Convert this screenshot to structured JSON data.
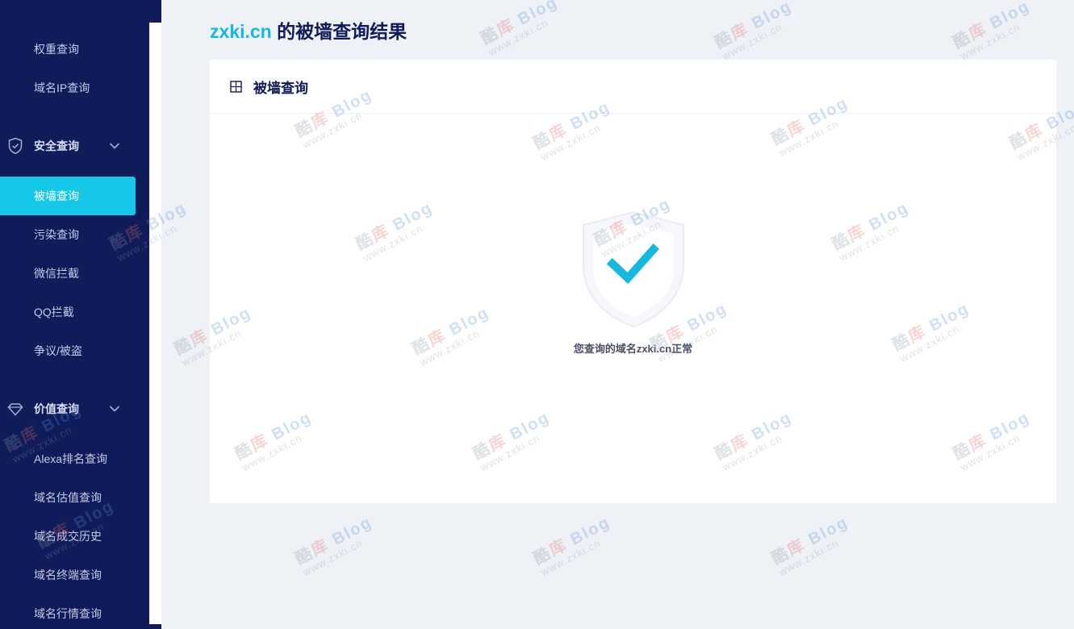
{
  "sidebar": {
    "items_top": [
      {
        "label": "权重查询"
      },
      {
        "label": "域名IP查询"
      }
    ],
    "groups": [
      {
        "label": "安全查询",
        "icon": "shield-icon"
      },
      {
        "label": "价值查询",
        "icon": "diamond-icon"
      }
    ],
    "security_items": [
      {
        "label": "被墙查询",
        "active": true
      },
      {
        "label": "污染查询"
      },
      {
        "label": "微信拦截"
      },
      {
        "label": "QQ拦截"
      },
      {
        "label": "争议/被盗"
      }
    ],
    "value_items": [
      {
        "label": "Alexa排名查询"
      },
      {
        "label": "域名估值查询"
      },
      {
        "label": "域名成交历史"
      },
      {
        "label": "域名终端查询"
      },
      {
        "label": "域名行情查询"
      }
    ]
  },
  "header": {
    "domain": "zxki.cn",
    "title_suffix": " 的被墙查询结果"
  },
  "card": {
    "title": "被墙查询",
    "result_text": "您查询的域名zxki.cn正常"
  },
  "watermark": {
    "line1_a": "酷",
    "line1_b": "库",
    "line1_c": "Blog",
    "line2": "www.zxki.cn"
  },
  "colors": {
    "sidebar_bg": "#101b59",
    "accent": "#16c8e8",
    "title": "#101b59"
  }
}
